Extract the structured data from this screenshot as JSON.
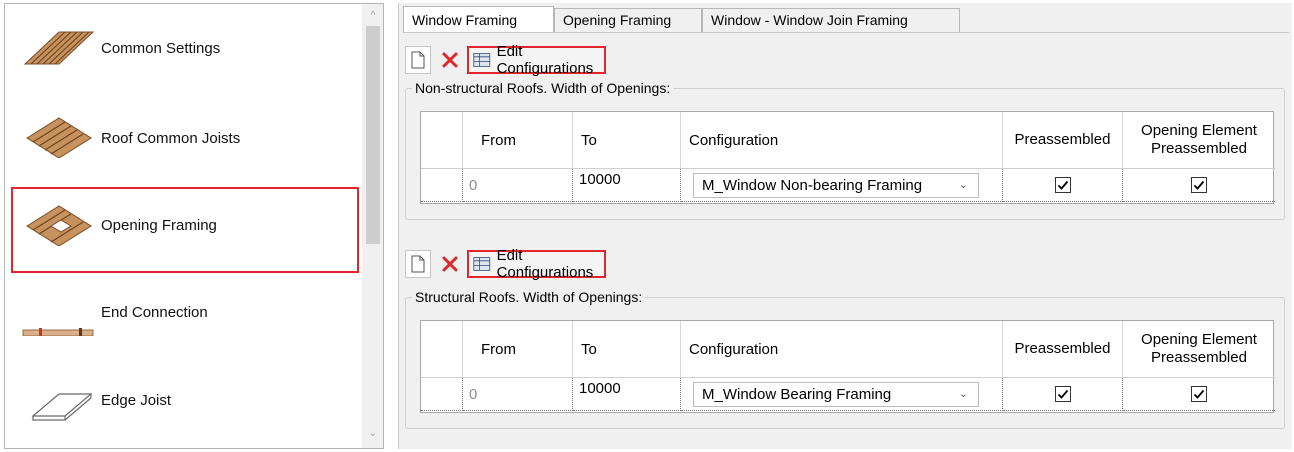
{
  "left_list": {
    "items": [
      {
        "label": "Common Settings",
        "icon": "common-settings-joists-icon"
      },
      {
        "label": "Roof Common Joists",
        "icon": "roof-common-joists-icon"
      },
      {
        "label": "Opening Framing",
        "icon": "opening-framing-icon",
        "selected": true
      },
      {
        "label": "End Connection",
        "icon": "end-connection-icon"
      },
      {
        "label": "Edge Joist",
        "icon": "edge-joist-icon"
      }
    ]
  },
  "tabs": [
    {
      "label": "Window Framing",
      "active": true
    },
    {
      "label": "Opening Framing",
      "active": false
    },
    {
      "label": "Window - Window Join Framing",
      "active": false
    }
  ],
  "toolbar": {
    "edit_label": "Edit Configurations"
  },
  "sections": [
    {
      "title": "Non-structural Roofs. Width of Openings:",
      "columns": [
        "From",
        "To",
        "Configuration",
        "Preassembled",
        "Opening Element Preassembled"
      ],
      "row": {
        "from": "0",
        "to": "10000",
        "configuration": "M_Window Non-bearing Framing",
        "preassembled": true,
        "opening_preassembled": true
      }
    },
    {
      "title": "Structural Roofs. Width of Openings:",
      "columns": [
        "From",
        "To",
        "Configuration",
        "Preassembled",
        "Opening Element Preassembled"
      ],
      "row": {
        "from": "0",
        "to": "10000",
        "configuration": "M_Window Bearing Framing",
        "preassembled": true,
        "opening_preassembled": true
      }
    }
  ],
  "colors": {
    "highlight_red": "#e0262b",
    "panel_bg": "#f0f0f0",
    "wood": "#b0784a"
  }
}
